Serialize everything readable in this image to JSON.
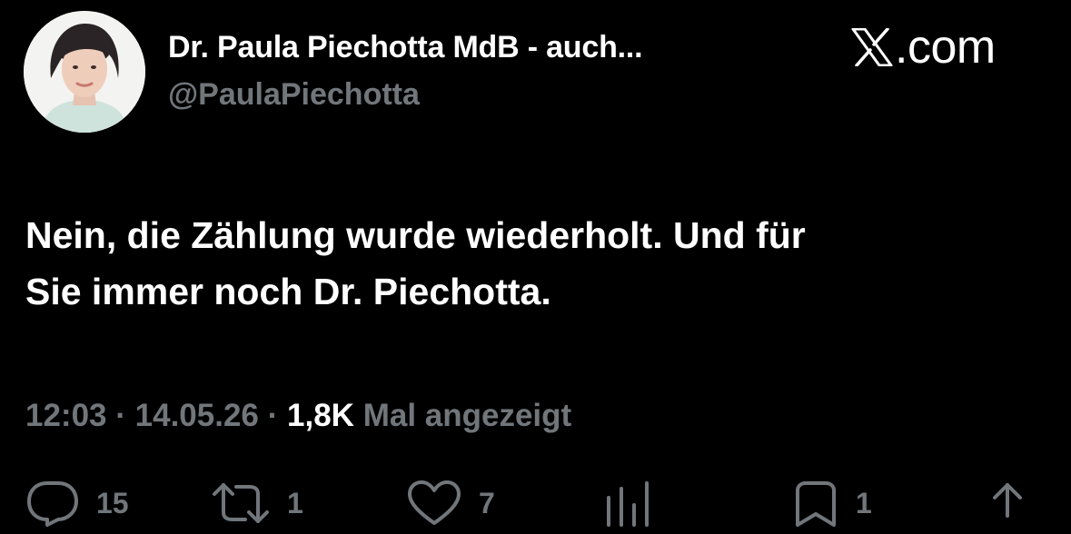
{
  "author": {
    "display_name": "Dr. Paula Piechotta MdB - auch...",
    "handle": "@PaulaPiechotta"
  },
  "brand": {
    "text": ".com",
    "icon": "x-logo-icon"
  },
  "tweet": {
    "text_line1": "Nein, die Zählung wurde wiederholt. Und für",
    "text_line2": "Sie immer noch Dr. Piechotta."
  },
  "meta": {
    "time": "12:03",
    "separator": "·",
    "date": "14.05.26",
    "views_count": "1,8K",
    "views_label": "Mal angezeigt"
  },
  "actions": {
    "reply": {
      "icon": "reply-icon",
      "count": "15"
    },
    "retweet": {
      "icon": "retweet-icon",
      "count": "1"
    },
    "like": {
      "icon": "heart-icon",
      "count": "7"
    },
    "bookmark": {
      "icon": "bookmark-icon",
      "count": "1"
    },
    "share": {
      "icon": "share-icon"
    }
  },
  "colors": {
    "background": "#000000",
    "primary_text": "#ffffff",
    "secondary_text": "#71767b"
  }
}
